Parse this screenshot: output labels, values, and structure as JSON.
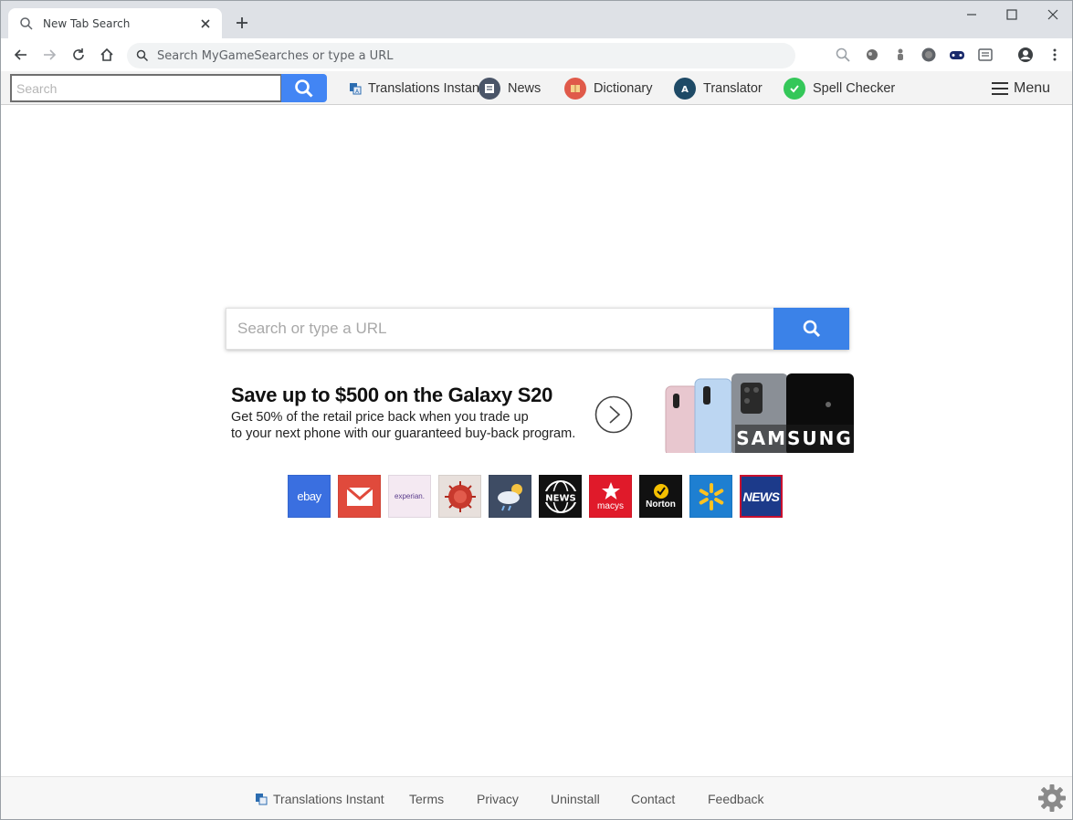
{
  "browser": {
    "tab_title": "New Tab Search",
    "omnibox_placeholder": "Search MyGameSearches or type a URL"
  },
  "extension_bar": {
    "search_placeholder": "Search",
    "links": [
      {
        "label": "Translations Instant",
        "icon": "translate-icon"
      },
      {
        "label": "News",
        "icon": "news-icon"
      },
      {
        "label": "Dictionary",
        "icon": "dictionary-icon"
      },
      {
        "label": "Translator",
        "icon": "translator-icon"
      },
      {
        "label": "Spell Checker",
        "icon": "check-icon"
      }
    ],
    "menu_label": "Menu"
  },
  "main": {
    "search_placeholder": "Search or type a URL"
  },
  "ad": {
    "title": "Save up to $500 on the Galaxy S20",
    "line1": "Get 50% of the retail price back when you trade up",
    "line2": "to your next phone with our guaranteed buy-back program.",
    "brand": "SAMSUNG"
  },
  "tiles": [
    {
      "name": "ebay",
      "label": "ebay",
      "bg": "#3a6fe0"
    },
    {
      "name": "gmail",
      "label": "",
      "bg": "#e04a3c"
    },
    {
      "name": "experian",
      "label": "experian.",
      "bg": "#f4e9f2"
    },
    {
      "name": "virus",
      "label": "",
      "bg": "#e8e0dc"
    },
    {
      "name": "weather",
      "label": "",
      "bg": "#3e4c64"
    },
    {
      "name": "news-globe",
      "label": "NEWS",
      "bg": "#111111"
    },
    {
      "name": "macys",
      "label": "macys",
      "bg": "#e01a2a"
    },
    {
      "name": "norton",
      "label": "Norton",
      "bg": "#111111"
    },
    {
      "name": "walmart",
      "label": "",
      "bg": "#1e7fd1"
    },
    {
      "name": "news",
      "label": "NEWS",
      "bg": "#1c3a8a"
    }
  ],
  "footer": {
    "links": [
      "Translations Instant",
      "Terms",
      "Privacy",
      "Uninstall",
      "Contact",
      "Feedback"
    ]
  },
  "colors": {
    "accent_blue": "#4285f4",
    "main_search_button": "#3b82e8",
    "tabstrip": "#dee1e6"
  }
}
